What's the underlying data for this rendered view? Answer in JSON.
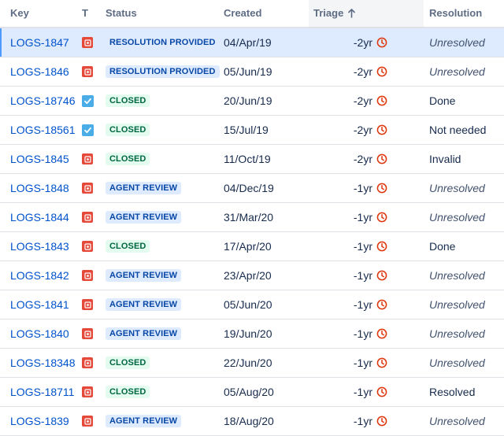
{
  "columns": {
    "key": "Key",
    "type": "T",
    "status": "Status",
    "created": "Created",
    "triage": "Triage",
    "resolution": "Resolution"
  },
  "sort": {
    "column": "triage",
    "direction": "ascending",
    "icon": "arrow-up-icon"
  },
  "colors": {
    "link": "#0052cc",
    "bug": "#e5493a",
    "task": "#4bade8",
    "clock": "#de350b",
    "status_blue_bg": "#deebff",
    "status_blue_text": "#0747a6",
    "status_green_bg": "#e3fcef",
    "status_green_text": "#006644",
    "selected_row": "#deebff"
  },
  "rows": [
    {
      "key": "LOGS-1847",
      "type": "bug",
      "status": "RESOLUTION PROVIDED",
      "status_color": "blue",
      "created": "04/Apr/19",
      "triage": "-2yr",
      "resolution": "Unresolved",
      "resolution_italic": true,
      "selected": true
    },
    {
      "key": "LOGS-1846",
      "type": "bug",
      "status": "RESOLUTION PROVIDED",
      "status_color": "blue",
      "created": "05/Jun/19",
      "triage": "-2yr",
      "resolution": "Unresolved",
      "resolution_italic": true
    },
    {
      "key": "LOGS-18746",
      "type": "task",
      "status": "CLOSED",
      "status_color": "green",
      "created": "20/Jun/19",
      "triage": "-2yr",
      "resolution": "Done",
      "resolution_italic": false
    },
    {
      "key": "LOGS-18561",
      "type": "task",
      "status": "CLOSED",
      "status_color": "green",
      "created": "15/Jul/19",
      "triage": "-2yr",
      "resolution": "Not needed",
      "resolution_italic": false
    },
    {
      "key": "LOGS-1845",
      "type": "bug",
      "status": "CLOSED",
      "status_color": "green",
      "created": "11/Oct/19",
      "triage": "-2yr",
      "resolution": "Invalid",
      "resolution_italic": false
    },
    {
      "key": "LOGS-1848",
      "type": "bug",
      "status": "AGENT REVIEW",
      "status_color": "blue",
      "created": "04/Dec/19",
      "triage": "-1yr",
      "resolution": "Unresolved",
      "resolution_italic": true
    },
    {
      "key": "LOGS-1844",
      "type": "bug",
      "status": "AGENT REVIEW",
      "status_color": "blue",
      "created": "31/Mar/20",
      "triage": "-1yr",
      "resolution": "Unresolved",
      "resolution_italic": true
    },
    {
      "key": "LOGS-1843",
      "type": "bug",
      "status": "CLOSED",
      "status_color": "green",
      "created": "17/Apr/20",
      "triage": "-1yr",
      "resolution": "Done",
      "resolution_italic": false
    },
    {
      "key": "LOGS-1842",
      "type": "bug",
      "status": "AGENT REVIEW",
      "status_color": "blue",
      "created": "23/Apr/20",
      "triage": "-1yr",
      "resolution": "Unresolved",
      "resolution_italic": true
    },
    {
      "key": "LOGS-1841",
      "type": "bug",
      "status": "AGENT REVIEW",
      "status_color": "blue",
      "created": "05/Jun/20",
      "triage": "-1yr",
      "resolution": "Unresolved",
      "resolution_italic": true
    },
    {
      "key": "LOGS-1840",
      "type": "bug",
      "status": "AGENT REVIEW",
      "status_color": "blue",
      "created": "19/Jun/20",
      "triage": "-1yr",
      "resolution": "Unresolved",
      "resolution_italic": true
    },
    {
      "key": "LOGS-18348",
      "type": "bug",
      "status": "CLOSED",
      "status_color": "green",
      "created": "22/Jun/20",
      "triage": "-1yr",
      "resolution": "Unresolved",
      "resolution_italic": true
    },
    {
      "key": "LOGS-18711",
      "type": "bug",
      "status": "CLOSED",
      "status_color": "green",
      "created": "05/Aug/20",
      "triage": "-1yr",
      "resolution": "Resolved",
      "resolution_italic": false
    },
    {
      "key": "LOGS-1839",
      "type": "bug",
      "status": "AGENT REVIEW",
      "status_color": "blue",
      "created": "18/Aug/20",
      "triage": "-1yr",
      "resolution": "Unresolved",
      "resolution_italic": true
    }
  ]
}
